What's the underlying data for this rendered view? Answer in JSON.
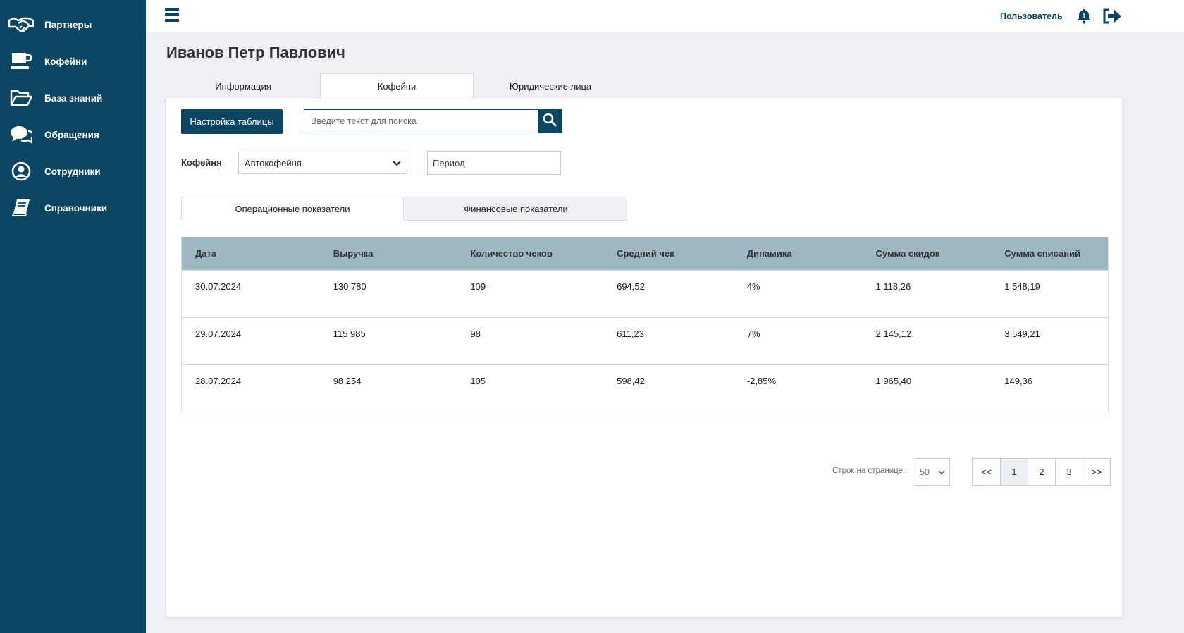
{
  "sidebar": {
    "items": [
      {
        "label": "Партнеры",
        "icon": "handshake-icon"
      },
      {
        "label": "Кофейни",
        "icon": "coffee-cup-icon"
      },
      {
        "label": "База знаний",
        "icon": "folder-open-icon"
      },
      {
        "label": "Обращения",
        "icon": "chat-bubbles-icon"
      },
      {
        "label": "Сотрудники",
        "icon": "user-circle-icon"
      },
      {
        "label": "Справочники",
        "icon": "book-icon"
      }
    ]
  },
  "header": {
    "user_label": "Пользователь",
    "notification_count": "1"
  },
  "page": {
    "title": "Иванов Петр Павлович"
  },
  "main_tabs": [
    {
      "label": "Информация"
    },
    {
      "label": "Кофейни"
    },
    {
      "label": "Юридические лица"
    }
  ],
  "toolbar": {
    "config_button": "Настройка таблицы",
    "search_placeholder": "Введите текст для поиска"
  },
  "filters": {
    "coffee_label": "Кофейня",
    "coffee_value": "Автокофейня",
    "period_placeholder": "Период"
  },
  "sub_tabs": [
    {
      "label": "Операционные показатели"
    },
    {
      "label": "Финансовые показатели"
    }
  ],
  "table": {
    "headers": [
      "Дата",
      "Выручка",
      "Количество чеков",
      "Средний чек",
      "Динамика",
      "Сумма скидок",
      "Сумма списаний"
    ],
    "rows": [
      [
        "30.07.2024",
        "130 780",
        "109",
        "694,52",
        "4%",
        "1 118,26",
        "1 548,19"
      ],
      [
        "29.07.2024",
        "115 985",
        "98",
        "611,23",
        "7%",
        "2 145,12",
        "3 549,21"
      ],
      [
        "28.07.2024",
        "98 254",
        "105",
        "598,42",
        "-2,85%",
        "1 965,40",
        "149,36"
      ]
    ]
  },
  "pager": {
    "rows_label": "Строк на странице:",
    "per_page": "50",
    "prev": "<<",
    "pages": [
      "1",
      "2",
      "3"
    ],
    "next": ">>"
  },
  "colors": {
    "sidebar_bg": "#0b4562",
    "table_header_bg": "#9db8c3",
    "page_bg": "#eef0f6"
  }
}
